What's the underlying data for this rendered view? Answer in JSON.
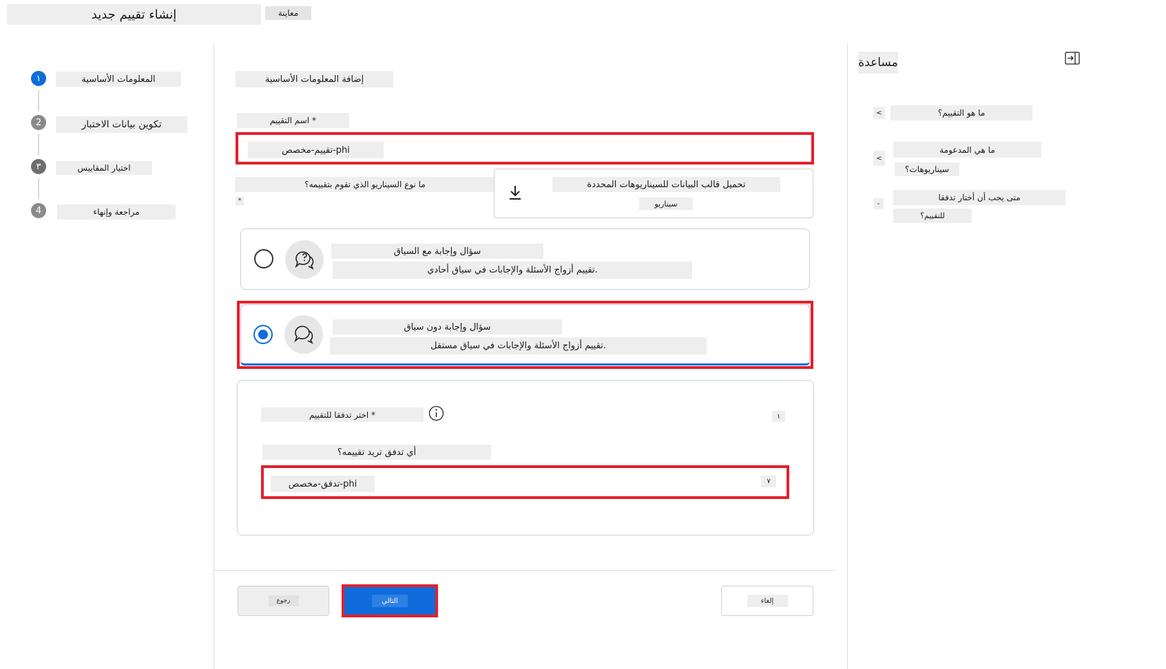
{
  "header": {
    "title": "إنشاء تقييم جديد",
    "preview_label": "معاينة"
  },
  "steps": [
    {
      "number": "١",
      "label": "المعلومات الأساسية",
      "state": "active"
    },
    {
      "number": "2",
      "label": "تكوين بيانات الاختبار",
      "state": "pending"
    },
    {
      "number": "٣",
      "label": "اختيار المقاييس",
      "state": "pending"
    },
    {
      "number": "4",
      "label": "مراجعة وإنهاء",
      "state": "pending"
    }
  ],
  "form": {
    "section_title": "إضافة المعلومات الأساسية",
    "name_label": "اسم التقييم *",
    "name_value": "تقييم-مخصص-phi",
    "scenario_label": "ما نوع السيناريو الذي تقوم بتقييمه؟",
    "scenario_required": "*",
    "download_title": "تحميل قالب البيانات للسيناريوهات المحددة",
    "download_subtitle": "سيناريو",
    "options": [
      {
        "title": "سؤال وإجابة مع السياق",
        "desc": "تقييم أزواج الأسئلة والإجابات في سياق أحادي.",
        "selected": false
      },
      {
        "title": "سؤال وإجابة دون سياق",
        "desc": "تقييم أزواج الأسئلة والإجابات في سياق مستقل.",
        "selected": true
      }
    ],
    "flow": {
      "label": "اختر تدفقا للتقييم *",
      "badge": "١",
      "question": "أي تدفق تريد تقييمه؟",
      "value": "تدفق-مخصص-phi",
      "chevron": "٧"
    }
  },
  "footer": {
    "back_label": "رجوع",
    "next_label": "التالي",
    "cancel_label": "إلغاء"
  },
  "help": {
    "title": "مساعدة",
    "items": [
      {
        "chevron": "<",
        "line1": "ما هو التقييم؟",
        "line2": ""
      },
      {
        "chevron": "<",
        "line1": "ما هي المدعومة",
        "line2": "سيناريوهات؟"
      },
      {
        "chevron": "-",
        "line1": "متى يجب أن أختار تدفقا",
        "line2": "للتقييم؟"
      }
    ]
  },
  "colors": {
    "accent": "#0f6cda",
    "highlight": "#e3202c"
  }
}
